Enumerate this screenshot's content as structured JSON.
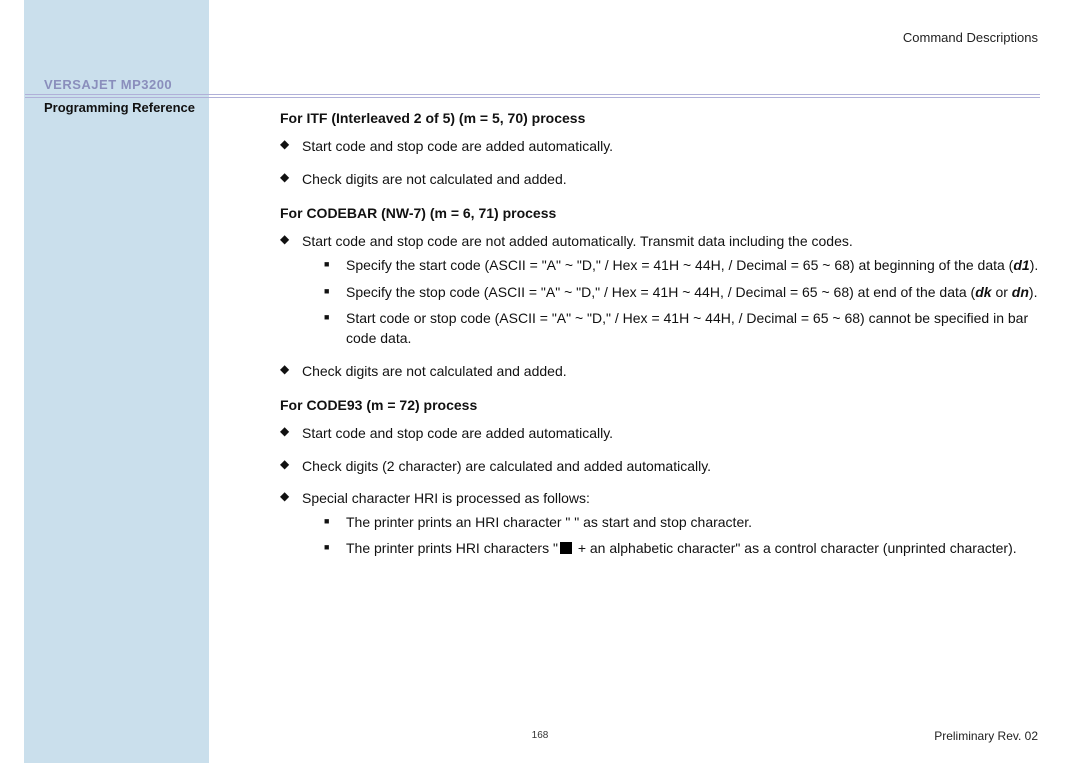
{
  "header": {
    "section": "Command  Descriptions"
  },
  "product": {
    "name": "VERSAJET MP3200",
    "subtitle": "Programming Reference"
  },
  "sections": {
    "s1": {
      "title": "For ITF (Interleaved 2 of 5) (m = 5, 70) process",
      "b1": "Start code and stop code are added automatically.",
      "b2": "Check digits are not calculated and added."
    },
    "s2": {
      "title": "For CODEBAR (NW-7) (m = 6, 71) process",
      "b1": "Start code and stop code are not added automatically. Transmit data including the codes.",
      "b1s1a": "Specify the start code (ASCII = \"A\" ~ \"D,\" / Hex = 41H ~ 44H, / Decimal = 65 ~ 68) at beginning of the data (",
      "b1s1em": "d1",
      "b1s1b": ").",
      "b1s2a": "Specify the stop code (ASCII = \"A\" ~ \"D,\" / Hex = 41H ~ 44H, / Decimal = 65 ~ 68) at end of the data (",
      "b1s2em1": "dk",
      "b1s2mid": " or ",
      "b1s2em2": "dn",
      "b1s2b": ").",
      "b1s3": "Start code or stop code (ASCII = \"A\" ~ \"D,\" / Hex = 41H ~ 44H, / Decimal = 65 ~ 68) cannot be specified in bar code data.",
      "b2": "Check digits are not calculated and added."
    },
    "s3": {
      "title": "For CODE93 (m = 72) process",
      "b1": "Start code and stop code are added automatically.",
      "b2": "Check digits (2 character) are calculated and added automatically.",
      "b3": "Special character HRI is processed as follows:",
      "b3s1": "The printer prints an HRI character \" \" as start and stop character.",
      "b3s2a": "The printer prints HRI characters \"",
      "b3s2b": " + an alphabetic character\" as a control character (unprinted character)."
    }
  },
  "footer": {
    "page": "168",
    "rev": "Preliminary Rev. 02"
  }
}
